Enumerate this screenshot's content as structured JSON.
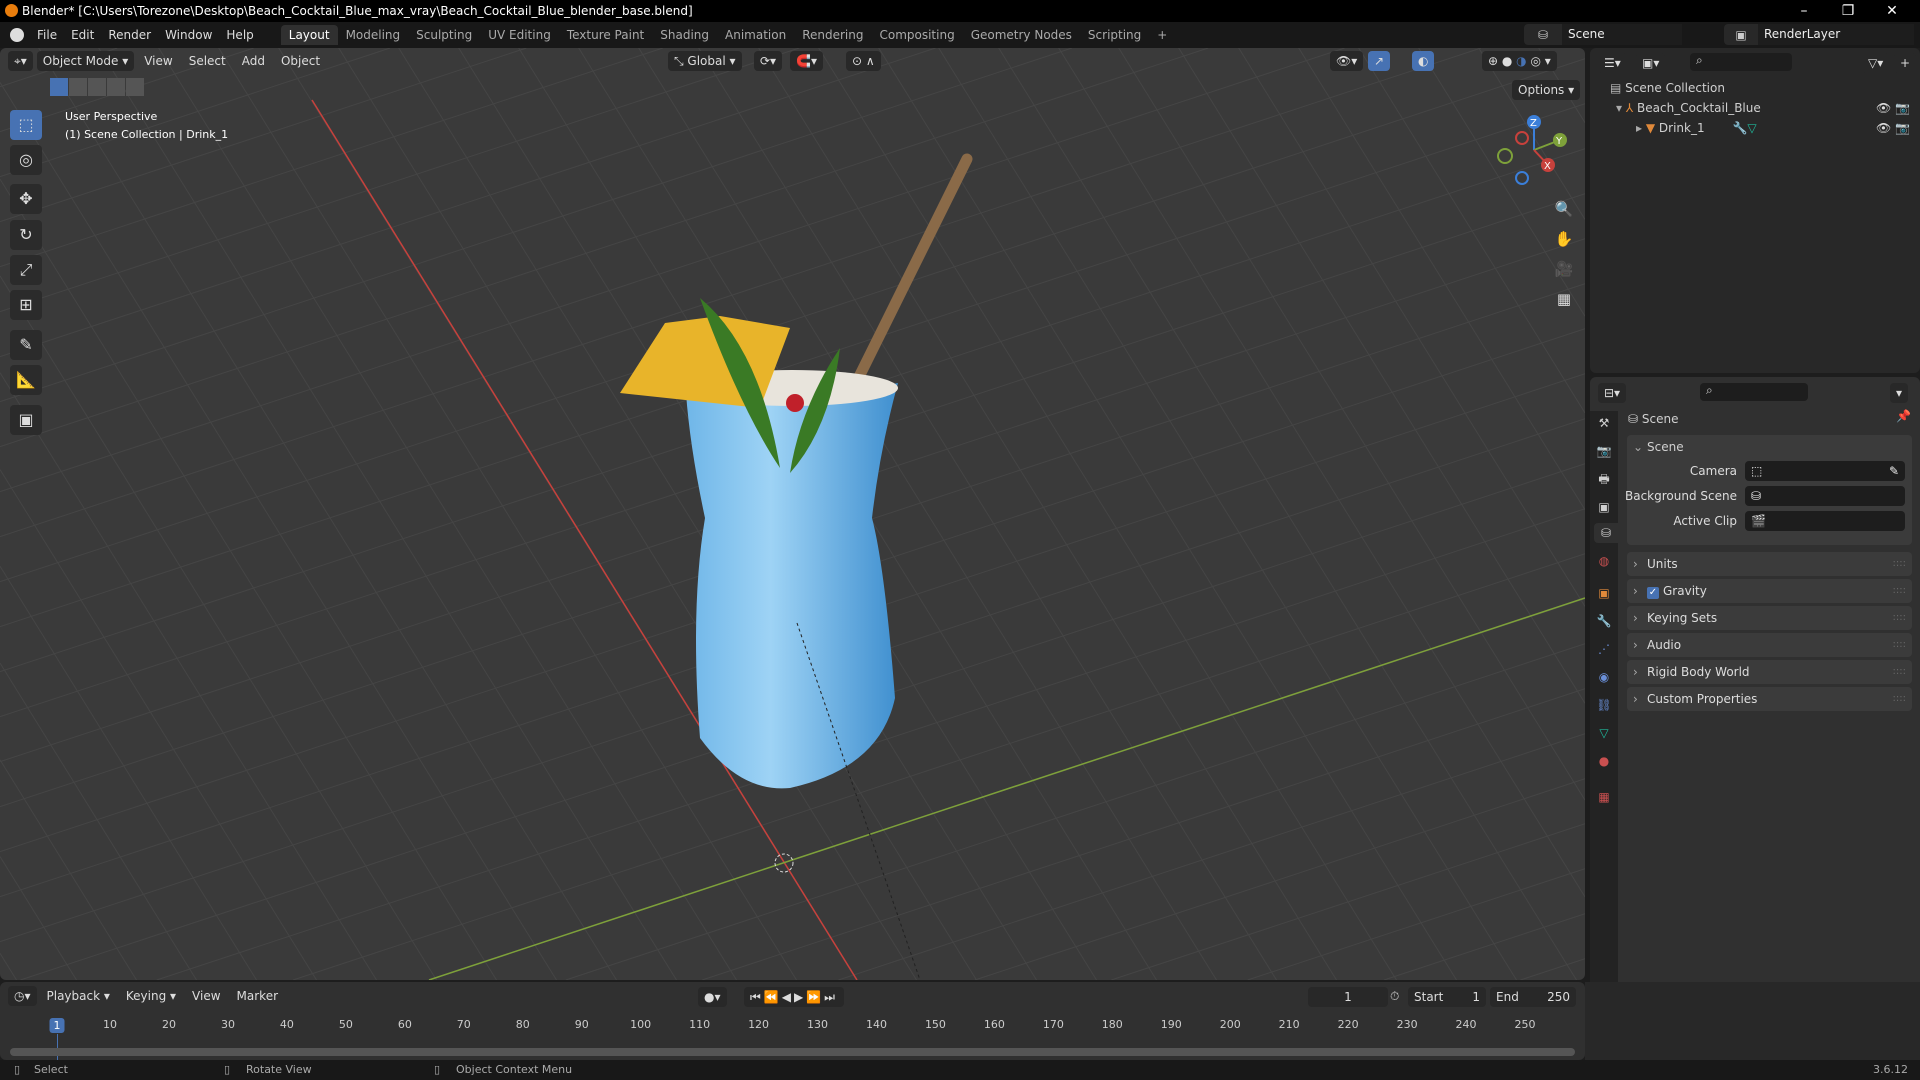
{
  "window": {
    "title": "Blender* [C:\\Users\\Torezone\\Desktop\\Beach_Cocktail_Blue_max_vray\\Beach_Cocktail_Blue_blender_base.blend]"
  },
  "menus": [
    "File",
    "Edit",
    "Render",
    "Window",
    "Help"
  ],
  "workspaces": [
    "Layout",
    "Modeling",
    "Sculpting",
    "UV Editing",
    "Texture Paint",
    "Shading",
    "Animation",
    "Rendering",
    "Compositing",
    "Geometry Nodes",
    "Scripting",
    "+"
  ],
  "active_workspace": "Layout",
  "scene_selector": {
    "scene": "Scene",
    "view_layer": "RenderLayer"
  },
  "viewport": {
    "mode": "Object Mode",
    "menus": [
      "View",
      "Select",
      "Add",
      "Object"
    ],
    "transform_orientation": "Global",
    "options_label": "Options",
    "overlay_line1": "User Perspective",
    "overlay_line2": "(1) Scene Collection | Drink_1",
    "gizmo_axes": [
      "X",
      "Y",
      "Z"
    ]
  },
  "outliner": {
    "root": "Scene Collection",
    "items": [
      {
        "name": "Beach_Cocktail_Blue",
        "type": "empty",
        "expanded": true
      },
      {
        "name": "Drink_1",
        "type": "mesh",
        "expanded": false
      }
    ]
  },
  "properties": {
    "context": "Scene",
    "panels": {
      "scene": "Scene",
      "camera_label": "Camera",
      "background_scene_label": "Background Scene",
      "active_clip_label": "Active Clip",
      "units": "Units",
      "gravity": "Gravity",
      "gravity_checked": true,
      "keying_sets": "Keying Sets",
      "audio": "Audio",
      "rigid_body_world": "Rigid Body World",
      "custom_properties": "Custom Properties"
    }
  },
  "timeline": {
    "menus": [
      "Playback",
      "Keying",
      "View",
      "Marker"
    ],
    "current_frame": "1",
    "start_label": "Start",
    "start": "1",
    "end_label": "End",
    "end": "250",
    "ticks": [
      "1",
      "10",
      "20",
      "30",
      "40",
      "50",
      "60",
      "70",
      "80",
      "90",
      "100",
      "110",
      "120",
      "130",
      "140",
      "150",
      "160",
      "170",
      "180",
      "190",
      "200",
      "210",
      "220",
      "230",
      "240",
      "250"
    ]
  },
  "status": {
    "select": "Select",
    "rotate": "Rotate View",
    "context_menu": "Object Context Menu",
    "version": "3.6.12"
  },
  "colors": {
    "accent": "#4772b3",
    "x_axis": "#c7413c",
    "y_axis": "#7ea13a",
    "z_axis": "#3b7fd9"
  }
}
